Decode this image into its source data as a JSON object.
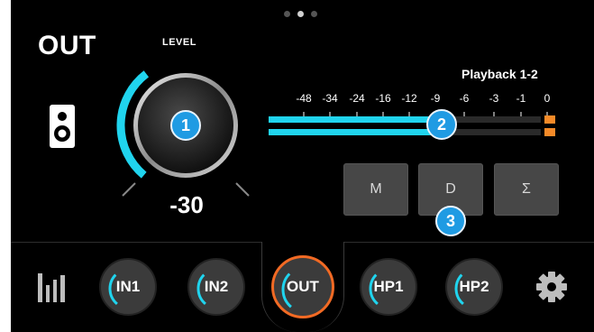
{
  "page": {
    "title": "OUT"
  },
  "pager": {
    "dot_count": 3,
    "active_index": 1
  },
  "knob": {
    "label": "LEVEL",
    "value": "-30",
    "level_fraction": 0.38
  },
  "meter": {
    "label": "Playback 1-2",
    "scale_ticks": [
      "-48",
      "-34",
      "-24",
      "-16",
      "-12",
      "-9",
      "-6",
      "-3",
      "-1",
      "0"
    ],
    "channels": [
      {
        "level_fraction": 0.62
      },
      {
        "level_fraction": 0.62
      }
    ]
  },
  "buttons": {
    "mute": "M",
    "dim": "D",
    "sum": "Σ"
  },
  "badges": {
    "knob": "1",
    "meter": "2",
    "buttons": "3"
  },
  "bottom_bar": {
    "channels": [
      {
        "label": "IN1",
        "level_fraction": 0.35,
        "active": false
      },
      {
        "label": "IN2",
        "level_fraction": 0.35,
        "active": false
      },
      {
        "label": "OUT",
        "level_fraction": 0.35,
        "active": true
      },
      {
        "label": "HP1",
        "level_fraction": 0.35,
        "active": false
      },
      {
        "label": "HP2",
        "level_fraction": 0.35,
        "active": false
      }
    ]
  },
  "colors": {
    "accent": "#20d4ee",
    "active": "#f26a24",
    "badge": "#1f9be3",
    "clip": "#f58a28"
  },
  "icons": {
    "output": "speaker-icon",
    "meters": "meter-bars-icon",
    "settings": "gear-icon"
  }
}
